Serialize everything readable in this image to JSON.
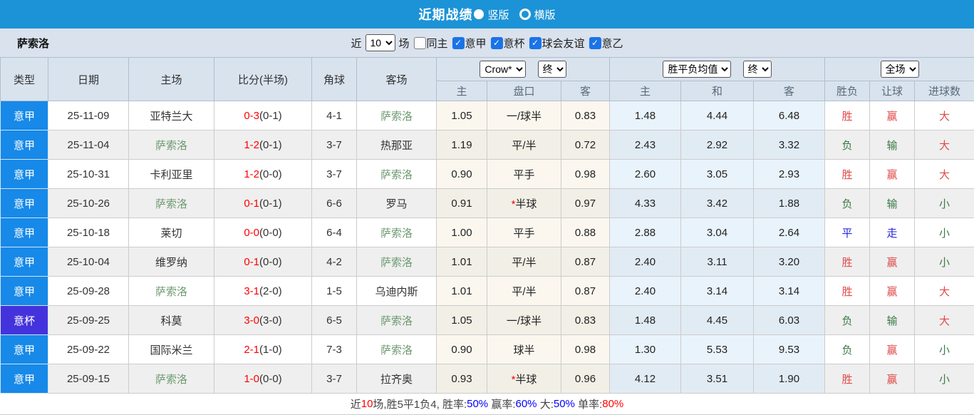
{
  "colors": {
    "topbar_blue": "#1c93d6",
    "serie_a_blue": "#1789e8",
    "cup_purple": "#4433dd",
    "team_green": "#6d9a70",
    "score_red": "#ff0000",
    "result_red": "#e04a4a",
    "result_green": "#3c7a46",
    "result_blue": "#2626d9"
  },
  "header": {
    "title": "近期战绩",
    "radio_vertical": "竖版",
    "radio_horizontal": "横版"
  },
  "controls": {
    "team_name": "萨索洛",
    "recent_label": "近",
    "recent_count": "10",
    "games_label": "场",
    "same_home_label": "同主",
    "filters": [
      {
        "label": "意甲",
        "checked": true
      },
      {
        "label": "意杯",
        "checked": true
      },
      {
        "label": "球会友谊",
        "checked": true
      },
      {
        "label": "意乙",
        "checked": true
      }
    ]
  },
  "table": {
    "columns": [
      "类型",
      "日期",
      "主场",
      "比分(半场)",
      "角球",
      "客场"
    ],
    "odds_group": {
      "select_company": "Crow*",
      "select_time": "终",
      "sub": [
        "主",
        "盘口",
        "客"
      ]
    },
    "avg_group": {
      "select_name": "胜平负均值",
      "select_time": "终",
      "sub": [
        "主",
        "和",
        "客"
      ]
    },
    "result_group": {
      "select_scope": "全场",
      "sub": [
        "胜负",
        "让球",
        "进球数"
      ]
    },
    "rows": [
      {
        "type": "意甲",
        "type_color": "blue",
        "date": "25-11-09",
        "home": "亚特兰大",
        "home_green": false,
        "score": "0-3",
        "half": "(0-1)",
        "corner": "4-1",
        "away": "萨索洛",
        "away_green": true,
        "odds_home": "1.05",
        "handicap": "一/球半",
        "handicap_star": false,
        "odds_away": "0.83",
        "avg_win": "1.48",
        "avg_draw": "4.44",
        "avg_lose": "6.48",
        "result": "胜",
        "result_color": "red",
        "handicap_result": "赢",
        "handicap_result_color": "red",
        "goals": "大",
        "goals_color": "red"
      },
      {
        "type": "意甲",
        "type_color": "blue",
        "date": "25-11-04",
        "home": "萨索洛",
        "home_green": true,
        "score": "1-2",
        "half": "(0-1)",
        "corner": "3-7",
        "away": "热那亚",
        "away_green": false,
        "odds_home": "1.19",
        "handicap": "平/半",
        "handicap_star": false,
        "odds_away": "0.72",
        "avg_win": "2.43",
        "avg_draw": "2.92",
        "avg_lose": "3.32",
        "result": "负",
        "result_color": "green",
        "handicap_result": "输",
        "handicap_result_color": "green",
        "goals": "大",
        "goals_color": "red"
      },
      {
        "type": "意甲",
        "type_color": "blue",
        "date": "25-10-31",
        "home": "卡利亚里",
        "home_green": false,
        "score": "1-2",
        "half": "(0-0)",
        "corner": "3-7",
        "away": "萨索洛",
        "away_green": true,
        "odds_home": "0.90",
        "handicap": "平手",
        "handicap_star": false,
        "odds_away": "0.98",
        "avg_win": "2.60",
        "avg_draw": "3.05",
        "avg_lose": "2.93",
        "result": "胜",
        "result_color": "red",
        "handicap_result": "赢",
        "handicap_result_color": "red",
        "goals": "大",
        "goals_color": "red"
      },
      {
        "type": "意甲",
        "type_color": "blue",
        "date": "25-10-26",
        "home": "萨索洛",
        "home_green": true,
        "score": "0-1",
        "half": "(0-1)",
        "corner": "6-6",
        "away": "罗马",
        "away_green": false,
        "odds_home": "0.91",
        "handicap": "半球",
        "handicap_star": true,
        "odds_away": "0.97",
        "avg_win": "4.33",
        "avg_draw": "3.42",
        "avg_lose": "1.88",
        "result": "负",
        "result_color": "green",
        "handicap_result": "输",
        "handicap_result_color": "green",
        "goals": "小",
        "goals_color": "green"
      },
      {
        "type": "意甲",
        "type_color": "blue",
        "date": "25-10-18",
        "home": "莱切",
        "home_green": false,
        "score": "0-0",
        "half": "(0-0)",
        "corner": "6-4",
        "away": "萨索洛",
        "away_green": true,
        "odds_home": "1.00",
        "handicap": "平手",
        "handicap_star": false,
        "odds_away": "0.88",
        "avg_win": "2.88",
        "avg_draw": "3.04",
        "avg_lose": "2.64",
        "result": "平",
        "result_color": "blue",
        "handicap_result": "走",
        "handicap_result_color": "blue",
        "goals": "小",
        "goals_color": "green"
      },
      {
        "type": "意甲",
        "type_color": "blue",
        "date": "25-10-04",
        "home": "维罗纳",
        "home_green": false,
        "score": "0-1",
        "half": "(0-0)",
        "corner": "4-2",
        "away": "萨索洛",
        "away_green": true,
        "odds_home": "1.01",
        "handicap": "平/半",
        "handicap_star": false,
        "odds_away": "0.87",
        "avg_win": "2.40",
        "avg_draw": "3.11",
        "avg_lose": "3.20",
        "result": "胜",
        "result_color": "red",
        "handicap_result": "赢",
        "handicap_result_color": "red",
        "goals": "小",
        "goals_color": "green"
      },
      {
        "type": "意甲",
        "type_color": "blue",
        "date": "25-09-28",
        "home": "萨索洛",
        "home_green": true,
        "score": "3-1",
        "half": "(2-0)",
        "corner": "1-5",
        "away": "乌迪内斯",
        "away_green": false,
        "odds_home": "1.01",
        "handicap": "平/半",
        "handicap_star": false,
        "odds_away": "0.87",
        "avg_win": "2.40",
        "avg_draw": "3.14",
        "avg_lose": "3.14",
        "result": "胜",
        "result_color": "red",
        "handicap_result": "赢",
        "handicap_result_color": "red",
        "goals": "大",
        "goals_color": "red"
      },
      {
        "type": "意杯",
        "type_color": "purple",
        "date": "25-09-25",
        "home": "科莫",
        "home_green": false,
        "score": "3-0",
        "half": "(3-0)",
        "corner": "6-5",
        "away": "萨索洛",
        "away_green": true,
        "odds_home": "1.05",
        "handicap": "一/球半",
        "handicap_star": false,
        "odds_away": "0.83",
        "avg_win": "1.48",
        "avg_draw": "4.45",
        "avg_lose": "6.03",
        "result": "负",
        "result_color": "green",
        "handicap_result": "输",
        "handicap_result_color": "green",
        "goals": "大",
        "goals_color": "red"
      },
      {
        "type": "意甲",
        "type_color": "blue",
        "date": "25-09-22",
        "home": "国际米兰",
        "home_green": false,
        "score": "2-1",
        "half": "(1-0)",
        "corner": "7-3",
        "away": "萨索洛",
        "away_green": true,
        "odds_home": "0.90",
        "handicap": "球半",
        "handicap_star": false,
        "odds_away": "0.98",
        "avg_win": "1.30",
        "avg_draw": "5.53",
        "avg_lose": "9.53",
        "result": "负",
        "result_color": "green",
        "handicap_result": "赢",
        "handicap_result_color": "red",
        "goals": "小",
        "goals_color": "green"
      },
      {
        "type": "意甲",
        "type_color": "blue",
        "date": "25-09-15",
        "home": "萨索洛",
        "home_green": true,
        "score": "1-0",
        "half": "(0-0)",
        "corner": "3-7",
        "away": "拉齐奥",
        "away_green": false,
        "odds_home": "0.93",
        "handicap": "半球",
        "handicap_star": true,
        "odds_away": "0.96",
        "avg_win": "4.12",
        "avg_draw": "3.51",
        "avg_lose": "1.90",
        "result": "胜",
        "result_color": "red",
        "handicap_result": "赢",
        "handicap_result_color": "red",
        "goals": "小",
        "goals_color": "green"
      }
    ]
  },
  "footer": {
    "segments": [
      {
        "text": "近",
        "color": "dark"
      },
      {
        "text": "10",
        "color": "red"
      },
      {
        "text": "场,胜5平1负4, 胜率:",
        "color": "dark"
      },
      {
        "text": "50%",
        "color": "blue"
      },
      {
        "text": " 赢率:",
        "color": "dark"
      },
      {
        "text": "60%",
        "color": "blue"
      },
      {
        "text": " 大:",
        "color": "dark"
      },
      {
        "text": "50%",
        "color": "blue"
      },
      {
        "text": " 单率:",
        "color": "dark"
      },
      {
        "text": "80%",
        "color": "red"
      }
    ]
  }
}
